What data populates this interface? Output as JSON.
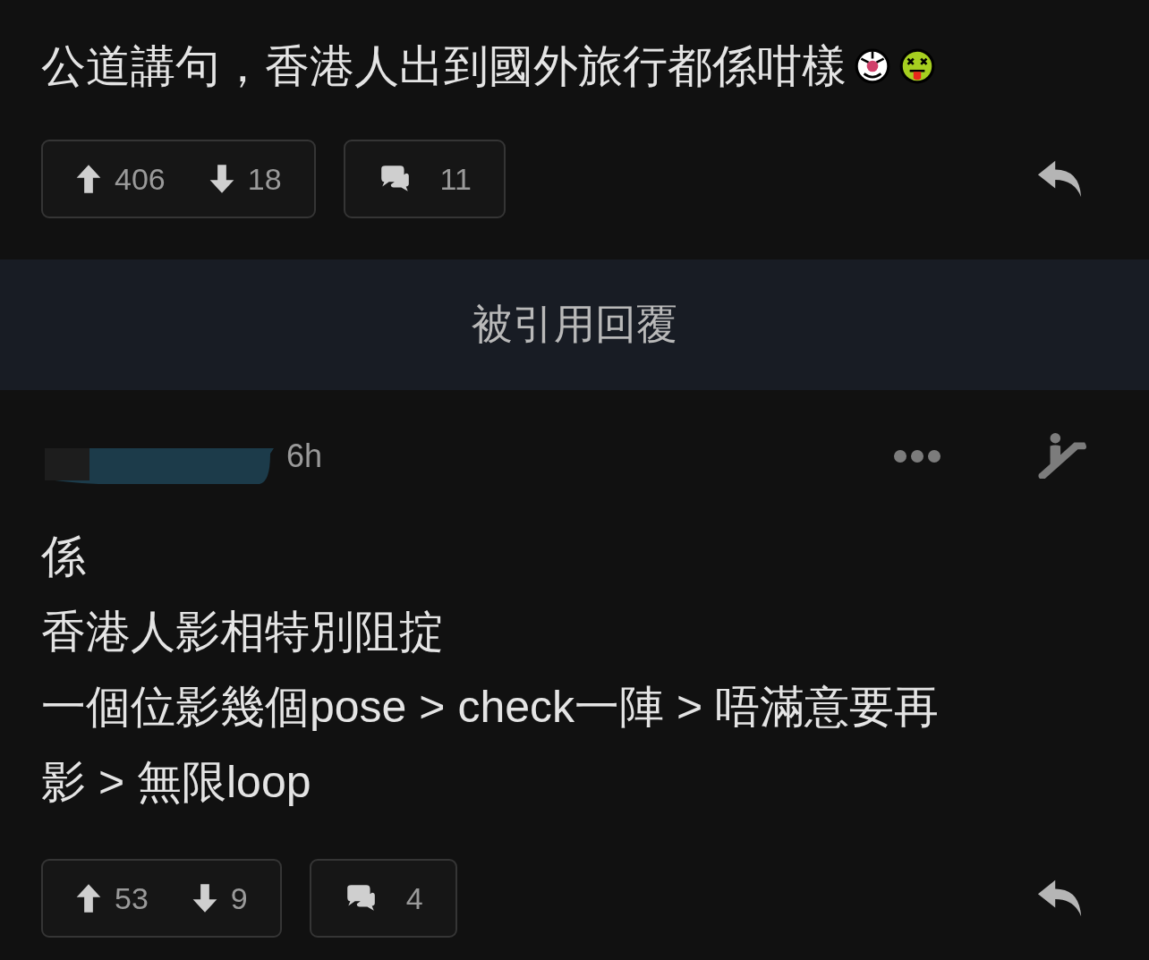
{
  "top_post": {
    "body_lines": [
      "公道講句，香港人出到國外旅行都係咁樣"
    ],
    "votes": {
      "up": "406",
      "down": "18"
    },
    "comments": "11"
  },
  "quoted_banner": {
    "label": "被引用回覆"
  },
  "reply": {
    "time": "6h",
    "body_lines": [
      "係",
      "香港人影相特別阻掟",
      "一個位影幾個pose > check一陣 > 唔滿意要再",
      "影 > 無限loop"
    ],
    "votes": {
      "up": "53",
      "down": "9"
    },
    "comments": "4"
  }
}
